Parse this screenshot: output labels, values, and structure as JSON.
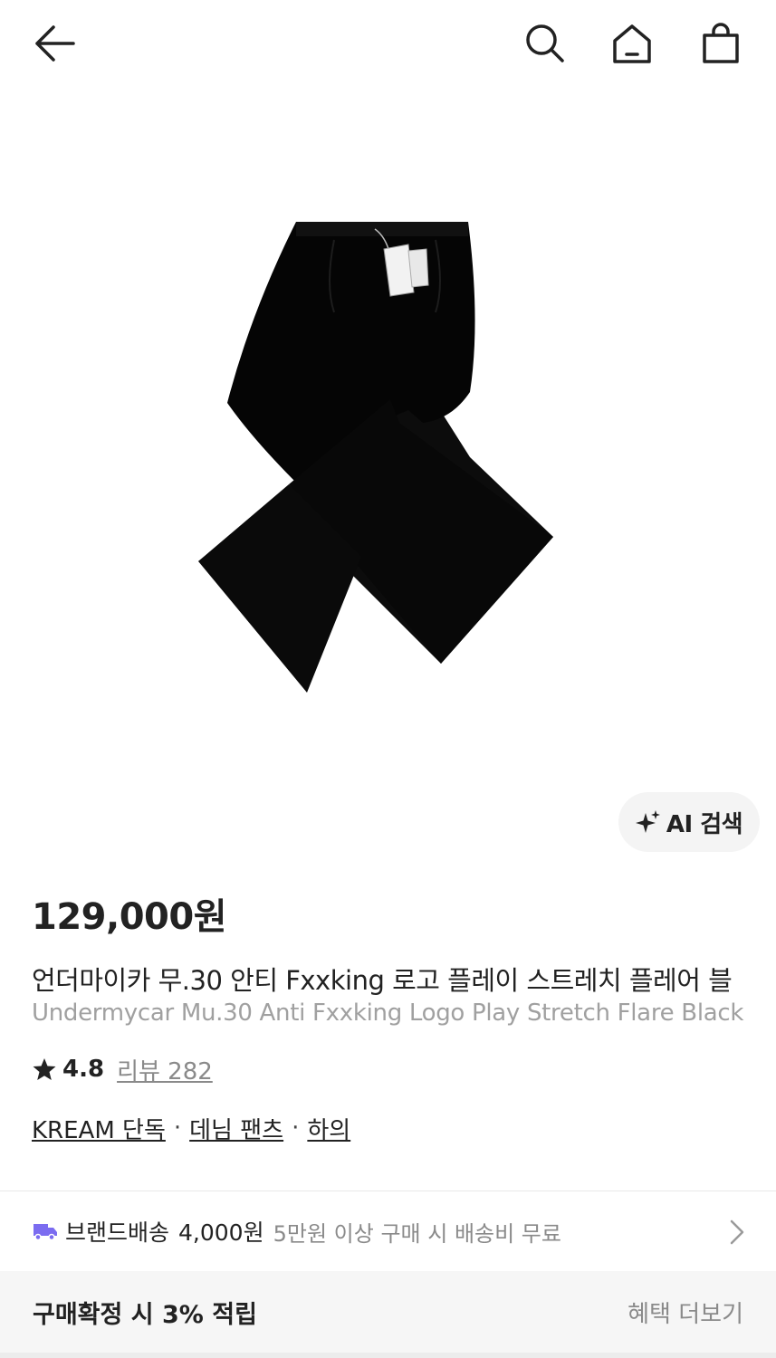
{
  "header": {
    "back_icon": "arrow-left-icon",
    "search_icon": "search-icon",
    "home_icon": "home-icon",
    "bag_icon": "shopping-bag-icon"
  },
  "product": {
    "image_icon": "black-flare-jeans-image",
    "ai_search_label": "AI 검색",
    "ai_icon": "sparkle-icon",
    "price": "129,000원",
    "title_ko": "언더마이카 무.30 안티 Fxxking 로고 플레이 스트레치 플레어 블",
    "title_en": "Undermycar Mu.30 Anti Fxxking Logo Play Stretch Flare Black",
    "rating_icon": "star-icon",
    "rating": "4.8",
    "review_label": "리뷰 282",
    "categories": [
      "KREAM 단독",
      "데님 팬츠",
      "하의"
    ],
    "category_separator": "·"
  },
  "shipping": {
    "icon": "truck-icon",
    "label": "브랜드배송",
    "fee": "4,000원",
    "note": "5만원 이상 구매 시 배송비 무료",
    "chevron_icon": "chevron-right-icon"
  },
  "benefit": {
    "label": "구매확정 시 3% 적립",
    "more_label": "혜택 더보기"
  },
  "colors": {
    "text": "#222222",
    "muted": "#8a8a8a",
    "truck": "#7b6cf0",
    "ai_bg": "#f4f4f4",
    "benefit_bg": "#f6f6f6"
  }
}
